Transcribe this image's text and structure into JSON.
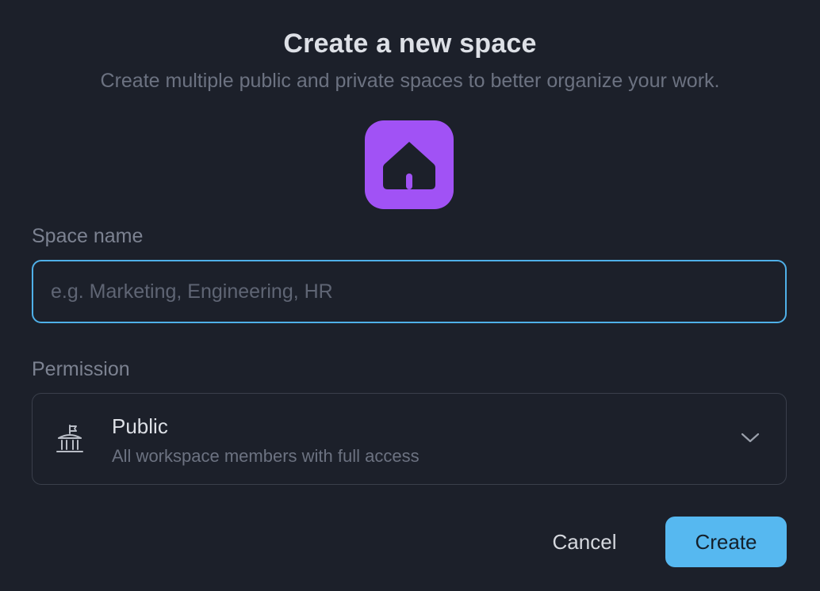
{
  "dialog": {
    "title": "Create a new space",
    "subtitle": "Create multiple public and private spaces to better organize your work.",
    "space_icon": {
      "icon": "home-icon",
      "color": "#a152f5"
    }
  },
  "form": {
    "name_label": "Space name",
    "name_value": "",
    "name_placeholder": "e.g. Marketing, Engineering, HR",
    "permission_label": "Permission",
    "permission": {
      "icon": "building-flag-icon",
      "selected_title": "Public",
      "selected_description": "All workspace members with full access"
    }
  },
  "actions": {
    "cancel_label": "Cancel",
    "create_label": "Create",
    "accent_color": "#56b8f0"
  }
}
